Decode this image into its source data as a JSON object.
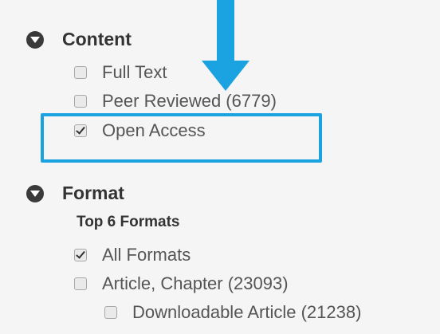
{
  "content_section": {
    "title": "Content",
    "items": [
      {
        "label": "Full Text",
        "checked": false
      },
      {
        "label": "Peer Reviewed (6779)",
        "checked": false
      },
      {
        "label": "Open Access",
        "checked": true
      }
    ]
  },
  "format_section": {
    "title": "Format",
    "subheading": "Top 6 Formats",
    "items": [
      {
        "label": "All Formats",
        "checked": true
      },
      {
        "label": "Article, Chapter (23093)",
        "checked": false
      },
      {
        "label": "Downloadable Article (21238)",
        "checked": false
      }
    ]
  },
  "annotation": {
    "color": "#1aa3e0",
    "arrow_icon": "down-arrow-icon",
    "target": "Open Access"
  }
}
